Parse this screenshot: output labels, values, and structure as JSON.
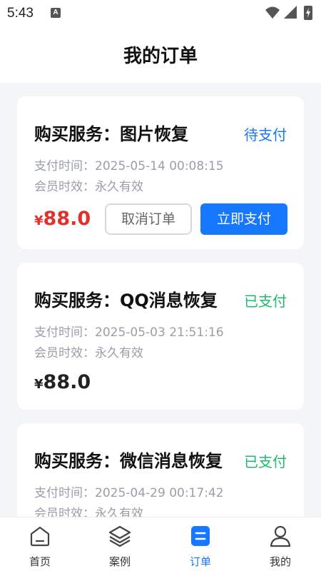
{
  "status_bar": {
    "time": "5:43",
    "notification_badge": "A"
  },
  "header": {
    "title": "我的订单"
  },
  "orders": [
    {
      "title": "购买服务：图片恢复",
      "status": "待支付",
      "pay_time_label": "支付时间：",
      "pay_time": "2025-05-14 00:08:15",
      "validity_label": "会员时效：",
      "validity": "永久有效",
      "currency": "¥",
      "price": "88.0",
      "cancel_label": "取消订单",
      "pay_label": "立即支付"
    },
    {
      "title": "购买服务：QQ消息恢复",
      "status": "已支付",
      "pay_time_label": "支付时间：",
      "pay_time": "2025-05-03 21:51:16",
      "validity_label": "会员时效：",
      "validity": "永久有效",
      "currency": "¥",
      "price": "88.0"
    },
    {
      "title": "购买服务：微信消息恢复",
      "status": "已支付",
      "pay_time_label": "支付时间：",
      "pay_time": "2025-04-29 00:17:42",
      "validity_label": "会员时效：",
      "validity": "永久有效"
    }
  ],
  "tabbar": {
    "items": [
      {
        "label": "首页",
        "icon": "home-icon"
      },
      {
        "label": "案例",
        "icon": "layers-icon"
      },
      {
        "label": "订单",
        "icon": "order-icon",
        "active": true
      },
      {
        "label": "我的",
        "icon": "user-icon"
      }
    ]
  },
  "colors": {
    "accent": "#1677ff",
    "paid": "#1bbd6a",
    "price_unpaid": "#e0312b"
  }
}
